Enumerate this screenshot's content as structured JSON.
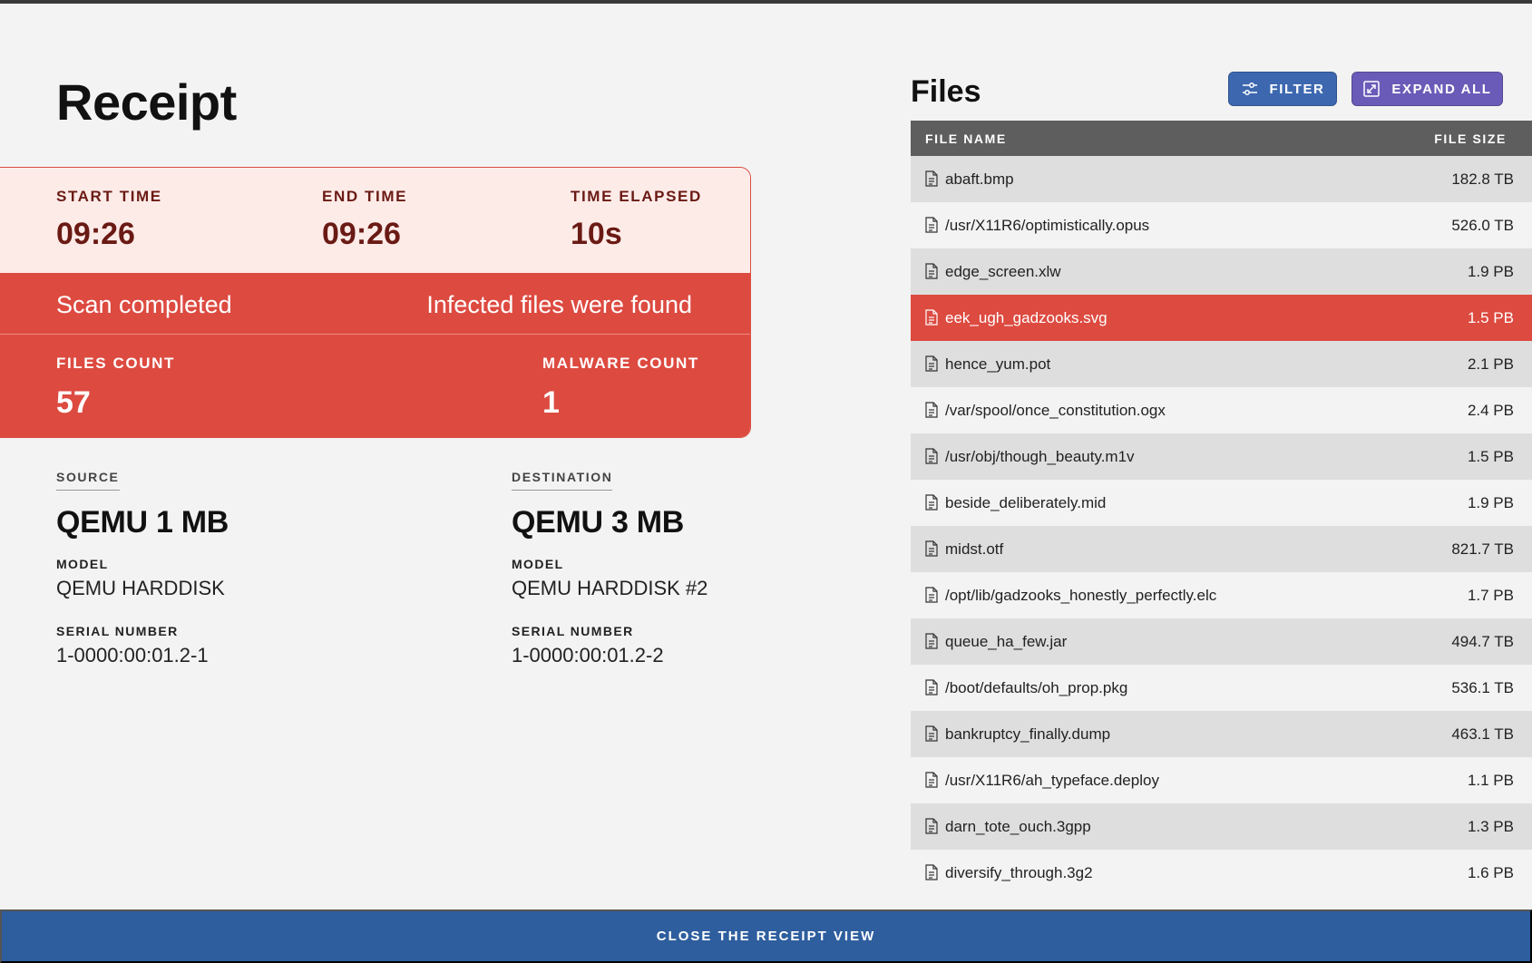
{
  "page": {
    "title": "Receipt"
  },
  "scan": {
    "start_label": "START TIME",
    "start_value": "09:26",
    "end_label": "END TIME",
    "end_value": "09:26",
    "elapsed_label": "TIME ELAPSED",
    "elapsed_value": "10s",
    "status": "Scan completed",
    "result": "Infected files were found",
    "files_count_label": "FILES COUNT",
    "files_count": "57",
    "malware_count_label": "MALWARE COUNT",
    "malware_count": "1"
  },
  "source": {
    "heading": "SOURCE",
    "name": "QEMU 1 MB",
    "model_label": "MODEL",
    "model": "QEMU HARDDISK",
    "serial_label": "SERIAL NUMBER",
    "serial": "1-0000:00:01.2-1"
  },
  "destination": {
    "heading": "DESTINATION",
    "name": "QEMU 3 MB",
    "model_label": "MODEL",
    "model": "QEMU HARDDISK #2",
    "serial_label": "SERIAL NUMBER",
    "serial": "1-0000:00:01.2-2"
  },
  "files": {
    "title": "Files",
    "filter_label": "FILTER",
    "expand_label": "EXPAND ALL",
    "columns": {
      "name": "FILE NAME",
      "size": "FILE SIZE"
    },
    "rows": [
      {
        "name": "abaft.bmp",
        "size": "182.8 TB",
        "infected": false
      },
      {
        "name": "/usr/X11R6/optimistically.opus",
        "size": "526.0 TB",
        "infected": false
      },
      {
        "name": "edge_screen.xlw",
        "size": "1.9 PB",
        "infected": false
      },
      {
        "name": "eek_ugh_gadzooks.svg",
        "size": "1.5 PB",
        "infected": true
      },
      {
        "name": "hence_yum.pot",
        "size": "2.1 PB",
        "infected": false
      },
      {
        "name": "/var/spool/once_constitution.ogx",
        "size": "2.4 PB",
        "infected": false
      },
      {
        "name": "/usr/obj/though_beauty.m1v",
        "size": "1.5 PB",
        "infected": false
      },
      {
        "name": "beside_deliberately.mid",
        "size": "1.9 PB",
        "infected": false
      },
      {
        "name": "midst.otf",
        "size": "821.7 TB",
        "infected": false
      },
      {
        "name": "/opt/lib/gadzooks_honestly_perfectly.elc",
        "size": "1.7 PB",
        "infected": false
      },
      {
        "name": "queue_ha_few.jar",
        "size": "494.7 TB",
        "infected": false
      },
      {
        "name": "/boot/defaults/oh_prop.pkg",
        "size": "536.1 TB",
        "infected": false
      },
      {
        "name": "bankruptcy_finally.dump",
        "size": "463.1 TB",
        "infected": false
      },
      {
        "name": "/usr/X11R6/ah_typeface.deploy",
        "size": "1.1 PB",
        "infected": false
      },
      {
        "name": "darn_tote_ouch.3gpp",
        "size": "1.3 PB",
        "infected": false
      },
      {
        "name": "diversify_through.3g2",
        "size": "1.6 PB",
        "infected": false
      }
    ]
  },
  "footer": {
    "close_label": "CLOSE THE RECEIPT VIEW"
  },
  "colors": {
    "alert_red": "#dd4a40",
    "alert_light": "#fdebe8",
    "primary_blue": "#3d68b0",
    "expand_purple": "#6b5bb8",
    "footer_blue": "#2e5e9e"
  },
  "icons": {
    "file": "file-text-icon",
    "filter": "sliders-icon",
    "expand": "expand-icon"
  }
}
